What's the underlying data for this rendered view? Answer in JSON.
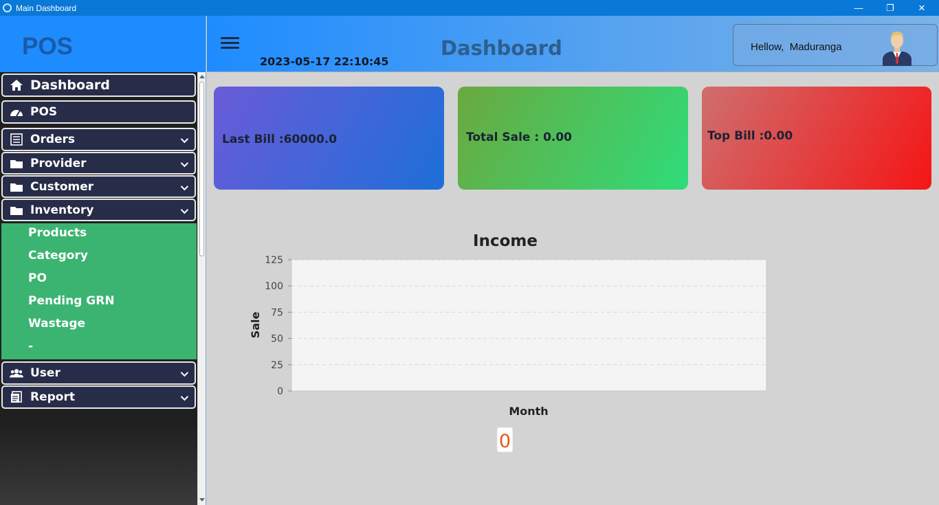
{
  "window": {
    "title": "Main Dashboard",
    "minimize": "—",
    "maximize": "❐",
    "close": "✕"
  },
  "sidebar": {
    "logo": "POS",
    "items": [
      {
        "label": "Dashboard",
        "icon": "home-icon"
      },
      {
        "label": "POS",
        "icon": "speedometer-icon"
      },
      {
        "label": "Orders",
        "icon": "list-icon"
      },
      {
        "label": "Provider",
        "icon": "folder-icon"
      },
      {
        "label": "Customer",
        "icon": "folder-icon"
      },
      {
        "label": "Inventory",
        "icon": "folder-icon"
      },
      {
        "label": "User",
        "icon": "users-icon"
      },
      {
        "label": "Report",
        "icon": "report-icon"
      }
    ],
    "inventory_sub": [
      "Products",
      "Category",
      "PO",
      "Pending GRN",
      "Wastage",
      "-"
    ]
  },
  "header": {
    "datetime": "2023-05-17 22:10:45",
    "title": "Dashboard",
    "greeting": "Hellow,",
    "username": "Maduranga"
  },
  "cards": [
    {
      "label": "Last Bill :60000.0",
      "colors": [
        "#6a5bd8",
        "#1d6fd8"
      ]
    },
    {
      "label": "Total Sale : 0.00",
      "colors": [
        "#6aa93f",
        "#2fdc7a"
      ]
    },
    {
      "label": "Top Bill :0.00",
      "colors": [
        "#cf6e6e",
        "#f51515"
      ]
    }
  ],
  "chart_data": {
    "type": "line",
    "title": "Income",
    "xlabel": "Month",
    "ylabel": "Sale",
    "ylim": [
      0,
      125
    ],
    "yticks": [
      0,
      25,
      50,
      75,
      100,
      125
    ],
    "series": [],
    "grid": true
  },
  "chart_extra": {
    "badge": "0"
  }
}
